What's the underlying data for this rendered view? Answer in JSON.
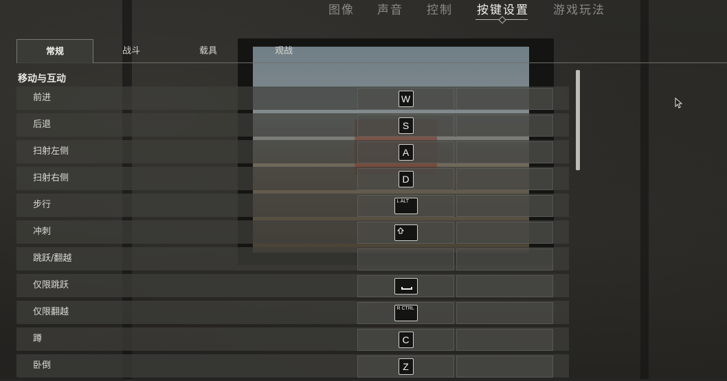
{
  "top_nav": {
    "items": [
      {
        "label": "图像"
      },
      {
        "label": "声音"
      },
      {
        "label": "控制"
      },
      {
        "label": "按键设置"
      },
      {
        "label": "游戏玩法"
      }
    ],
    "active": "按键设置"
  },
  "sub_tabs": [
    {
      "label": "常规"
    },
    {
      "label": "战斗"
    },
    {
      "label": "载具"
    },
    {
      "label": "观战"
    }
  ],
  "active_sub_tab": "常规",
  "section_title": "移动与互动",
  "bindings": [
    {
      "action": "前进",
      "primary": "W",
      "primary_icon": ""
    },
    {
      "action": "后退",
      "primary": "S",
      "primary_icon": ""
    },
    {
      "action": "扫射左侧",
      "primary": "A",
      "primary_icon": ""
    },
    {
      "action": "扫射右侧",
      "primary": "D",
      "primary_icon": ""
    },
    {
      "action": "步行",
      "primary": "L ALT",
      "primary_icon": ""
    },
    {
      "action": "冲刺",
      "primary": "",
      "primary_icon": "shift-icon"
    },
    {
      "action": "跳跃/翻越",
      "primary": "",
      "primary_icon": ""
    },
    {
      "action": "仅限跳跃",
      "primary": "",
      "primary_icon": "spacebar-icon"
    },
    {
      "action": "仅限翻越",
      "primary": "R CTRL",
      "primary_icon": ""
    },
    {
      "action": "蹲",
      "primary": "C",
      "primary_icon": ""
    },
    {
      "action": "卧倒",
      "primary": "Z",
      "primary_icon": ""
    }
  ]
}
